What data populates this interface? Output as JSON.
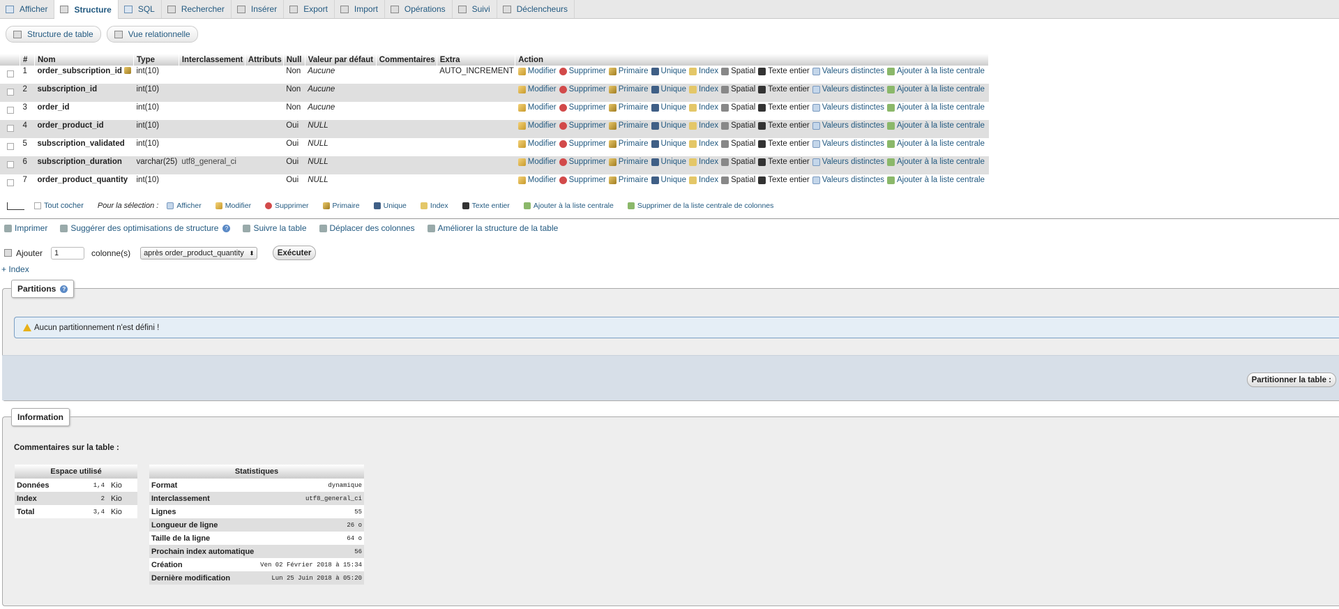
{
  "tabs": [
    {
      "label": "Afficher",
      "icon": "browse-icon"
    },
    {
      "label": "Structure",
      "icon": "structure-icon",
      "active": true
    },
    {
      "label": "SQL",
      "icon": "sql-icon"
    },
    {
      "label": "Rechercher",
      "icon": "search-icon"
    },
    {
      "label": "Insérer",
      "icon": "insert-icon"
    },
    {
      "label": "Export",
      "icon": "export-icon"
    },
    {
      "label": "Import",
      "icon": "import-icon"
    },
    {
      "label": "Opérations",
      "icon": "operations-icon"
    },
    {
      "label": "Suivi",
      "icon": "eye-icon"
    },
    {
      "label": "Déclencheurs",
      "icon": "triggers-icon"
    }
  ],
  "subtabs": {
    "structure": "Structure de table",
    "relational": "Vue relationnelle"
  },
  "table": {
    "headers": [
      "#",
      "Nom",
      "Type",
      "Interclassement",
      "Attributs",
      "Null",
      "Valeur par défaut",
      "Commentaires",
      "Extra",
      "Action"
    ],
    "rows": [
      {
        "num": "1",
        "name": "order_subscription_id",
        "type": "int(10)",
        "collation": "",
        "attributes": "",
        "null": "Non",
        "default": "Aucune",
        "comments": "",
        "extra": "AUTO_INCREMENT",
        "primary_key": true
      },
      {
        "num": "2",
        "name": "subscription_id",
        "type": "int(10)",
        "collation": "",
        "attributes": "",
        "null": "Non",
        "default": "Aucune",
        "comments": "",
        "extra": ""
      },
      {
        "num": "3",
        "name": "order_id",
        "type": "int(10)",
        "collation": "",
        "attributes": "",
        "null": "Non",
        "default": "Aucune",
        "comments": "",
        "extra": ""
      },
      {
        "num": "4",
        "name": "order_product_id",
        "type": "int(10)",
        "collation": "",
        "attributes": "",
        "null": "Oui",
        "default": "NULL",
        "comments": "",
        "extra": ""
      },
      {
        "num": "5",
        "name": "subscription_validated",
        "type": "int(10)",
        "collation": "",
        "attributes": "",
        "null": "Oui",
        "default": "NULL",
        "comments": "",
        "extra": ""
      },
      {
        "num": "6",
        "name": "subscription_duration",
        "type": "varchar(25)",
        "collation": "utf8_general_ci",
        "attributes": "",
        "null": "Oui",
        "default": "NULL",
        "comments": "",
        "extra": ""
      },
      {
        "num": "7",
        "name": "order_product_quantity",
        "type": "int(10)",
        "collation": "",
        "attributes": "",
        "null": "Oui",
        "default": "NULL",
        "comments": "",
        "extra": ""
      }
    ],
    "actions": [
      {
        "label": "Modifier",
        "icon": "edit-icon",
        "linked": true
      },
      {
        "label": "Supprimer",
        "icon": "delete-icon",
        "linked": true
      },
      {
        "label": "Primaire",
        "icon": "primary-key-icon",
        "linked": true
      },
      {
        "label": "Unique",
        "icon": "unique-icon",
        "linked": true
      },
      {
        "label": "Index",
        "icon": "index-icon",
        "linked": true
      },
      {
        "label": "Spatial",
        "icon": "spatial-icon",
        "linked": false
      },
      {
        "label": "Texte entier",
        "icon": "fulltext-icon",
        "linked": false
      },
      {
        "label": "Valeurs distinctes",
        "icon": "distinct-values-icon",
        "linked": true
      },
      {
        "label": "Ajouter à la liste centrale",
        "icon": "add-central-icon",
        "linked": true
      }
    ]
  },
  "selection": {
    "check_all": "Tout cocher",
    "for_selection": "Pour la sélection :",
    "actions": [
      "Afficher",
      "Modifier",
      "Supprimer",
      "Primaire",
      "Unique",
      "Index",
      "Texte entier",
      "Ajouter à la liste centrale",
      "Supprimer de la liste centrale de colonnes"
    ]
  },
  "tools": {
    "print": "Imprimer",
    "suggest": "Suggérer des optimisations de structure",
    "track": "Suivre la table",
    "move": "Déplacer des colonnes",
    "improve": "Améliorer la structure de la table"
  },
  "add_columns": {
    "label": "Ajouter",
    "count": "1",
    "unit": "colonne(s)",
    "position": "après order_product_quantity",
    "execute": "Exécuter"
  },
  "index_link": "+ Index",
  "partitions": {
    "legend": "Partitions",
    "notice": "Aucun partitionnement n'est défini !",
    "button": "Partitionner la table :"
  },
  "information": {
    "legend": "Information",
    "comments_label": "Commentaires sur la table :",
    "space": {
      "header": "Espace utilisé",
      "rows": [
        {
          "k": "Données",
          "v": "1,4",
          "u": "Kio"
        },
        {
          "k": "Index",
          "v": "2",
          "u": "Kio"
        },
        {
          "k": "Total",
          "v": "3,4",
          "u": "Kio"
        }
      ]
    },
    "stats": {
      "header": "Statistiques",
      "rows": [
        {
          "k": "Format",
          "v": "dynamique"
        },
        {
          "k": "Interclassement",
          "v": "utf8_general_ci"
        },
        {
          "k": "Lignes",
          "v": "55"
        },
        {
          "k": "Longueur de ligne",
          "v": "26 o"
        },
        {
          "k": "Taille de la ligne",
          "v": "64 o"
        },
        {
          "k": "Prochain index automatique",
          "v": "56"
        },
        {
          "k": "Création",
          "v": "Ven 02 Février 2018 à 15:34"
        },
        {
          "k": "Dernière modification",
          "v": "Lun 25 Juin 2018 à 05:20"
        }
      ]
    }
  }
}
